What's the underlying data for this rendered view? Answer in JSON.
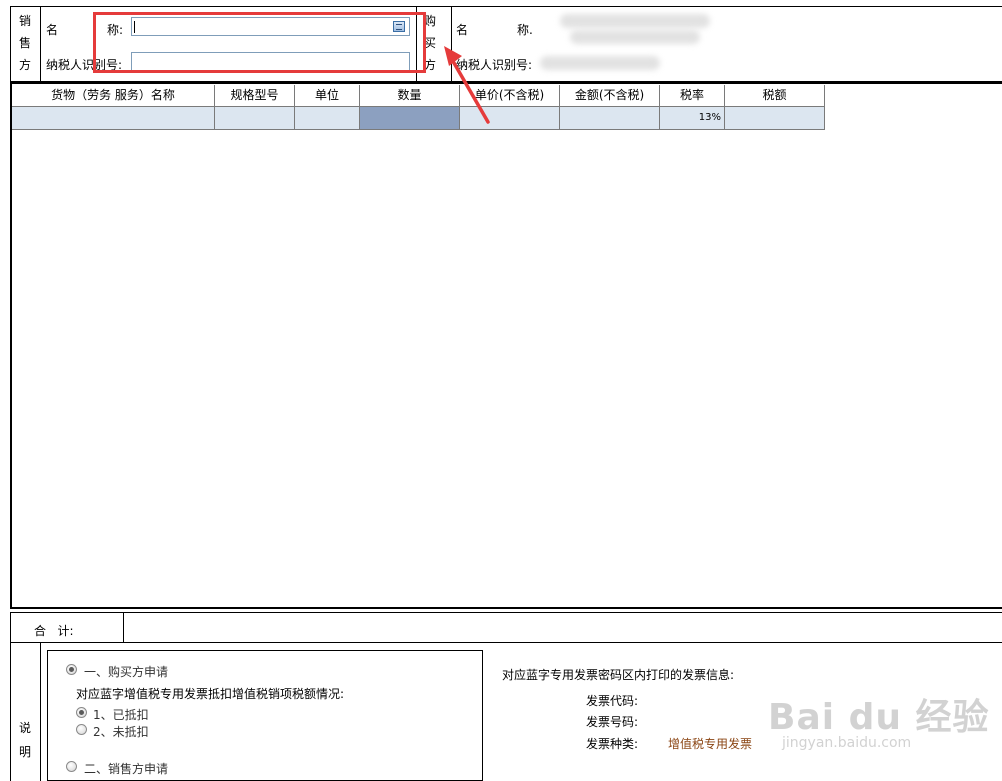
{
  "seller": {
    "side_label": [
      "销",
      "售",
      "方"
    ],
    "name_label": "名",
    "name_label_2": "称:",
    "name_value": "",
    "tax_id_label": "纳税人识别号:",
    "tax_id_value": ""
  },
  "buyer": {
    "side_label": [
      "购",
      "买",
      "方"
    ],
    "name_label": "名",
    "name_label_2": "称.",
    "tax_id_label": "纳税人识别号:"
  },
  "goods_table": {
    "headers": [
      "货物（劳务 服务）名称",
      "规格型号",
      "单位",
      "数量",
      "单价(不含税)",
      "金额(不含税)",
      "税率",
      "税额"
    ],
    "row": [
      "",
      "",
      "",
      "",
      "",
      "",
      "13%",
      ""
    ]
  },
  "total": {
    "label": "合   计:"
  },
  "notes": {
    "side_label": [
      "说",
      "明"
    ],
    "option_buyer": "一、购买方申请",
    "deduct_question": "对应蓝字增值税专用发票抵扣增值税销项税额情况:",
    "option_deducted": "1、已抵扣",
    "option_not_deducted": "2、未抵扣",
    "option_seller": "二、销售方申请",
    "info_title": "对应蓝字专用发票密码区内打印的发票信息:",
    "invoice_code_label": "发票代码:",
    "invoice_number_label": "发票号码:",
    "invoice_type_label": "发票种类:",
    "invoice_type_value": "增值税专用发票"
  },
  "watermark": {
    "brand": "Bai du 经验",
    "url": "jingyan.baidu.com"
  },
  "colors": {
    "annotation_red": "#e53b3b",
    "selected_cell": "#8ca0c0",
    "row_bg": "#dce6f0",
    "invoice_type_color": "#8b4513"
  }
}
